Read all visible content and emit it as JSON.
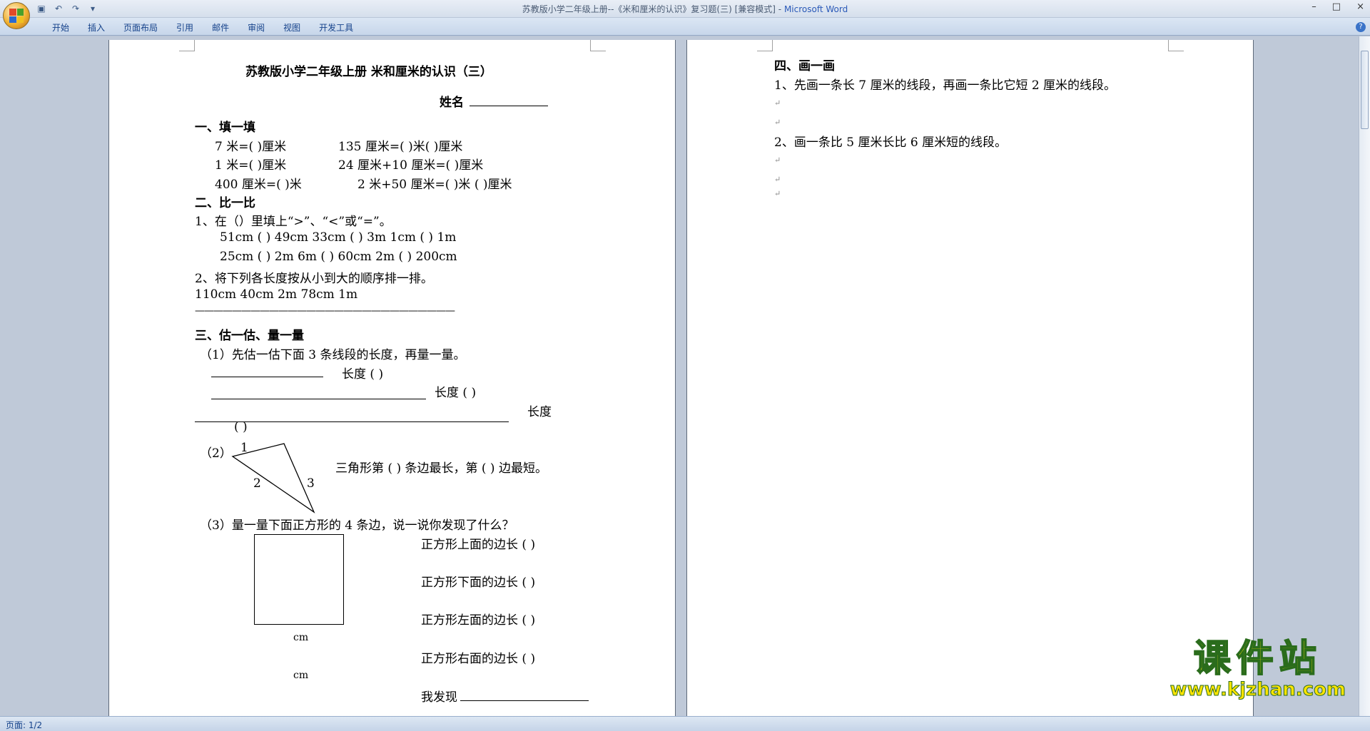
{
  "window": {
    "title": "苏教版小学二年级上册--《米和厘米的认识》复习题(三) [兼容模式] - ",
    "app": "Microsoft Word",
    "help_label": "?"
  },
  "ribbon": {
    "tabs": [
      "开始",
      "插入",
      "页面布局",
      "引用",
      "邮件",
      "审阅",
      "视图",
      "开发工具"
    ]
  },
  "status": {
    "page": "页面: 1/2"
  },
  "page1": {
    "title": "苏教版小学二年级上册  米和厘米的认识（三）",
    "name_label": "姓名",
    "sec1": "一、填一填",
    "s1_l1a": "7 米=(     )厘米",
    "s1_l1b": "135 厘米=(     )米(     )厘米",
    "s1_l2a": "1 米=(     )厘米",
    "s1_l2b": "24 厘米+10 厘米=(     )厘米",
    "s1_l3a": "400 厘米=(     )米",
    "s1_l3b": "2 米+50 厘米=(     )米 (      )厘米",
    "sec2": "二、比一比",
    "s2_q1": "1、在（）里填上“>”、“<”或“=”。",
    "s2_r1": "51cm (     ) 49cm    33cm (   ) 3m     1cm (   ) 1m",
    "s2_r2": "25cm (     ) 2m       6m (   ) 60cm    2m (   ) 200cm",
    "s2_q2": "2、将下列各长度按从小到大的顺序排一排。",
    "s2_vals": "110cm  40cm  2m  78cm  1m",
    "s2_dash": "————————————————————————————",
    "sec3": "三、估一估、量一量",
    "s3_q1": "（1）先估一估下面 3 条线段的长度，再量一量。",
    "s3_len1": "长度 (     )",
    "s3_len2": "长度 (        )",
    "s3_len3": "长度",
    "s3_len3b": "(        )",
    "s3_q2": "（2）",
    "tri_1": "1",
    "tri_2": "2",
    "tri_3": "3",
    "s3_tri": "三角形第 ( ) 条边最长，第 ( ) 边最短。",
    "s3_q3": "（3）量一量下面正方形的 4 条边，说一说你发现了什么？",
    "sq_top": "正方形上面的边长 (     )",
    "sq_bottom": "正方形下面的边长 (     )",
    "sq_left": "正方形左面的边长 (     )",
    "sq_right": "正方形右面的边长 (     )",
    "cm1": "cm",
    "cm2": "cm",
    "found": "我发现"
  },
  "page2": {
    "sec4": "四、画一画",
    "q1": "1、先画一条长 7 厘米的线段，再画一条比它短 2 厘米的线段。",
    "q2": "2、画一条比 5 厘米长比 6 厘米短的线段。"
  },
  "watermark": {
    "line1": "课件站",
    "line2": "www.kjzhan.com"
  }
}
